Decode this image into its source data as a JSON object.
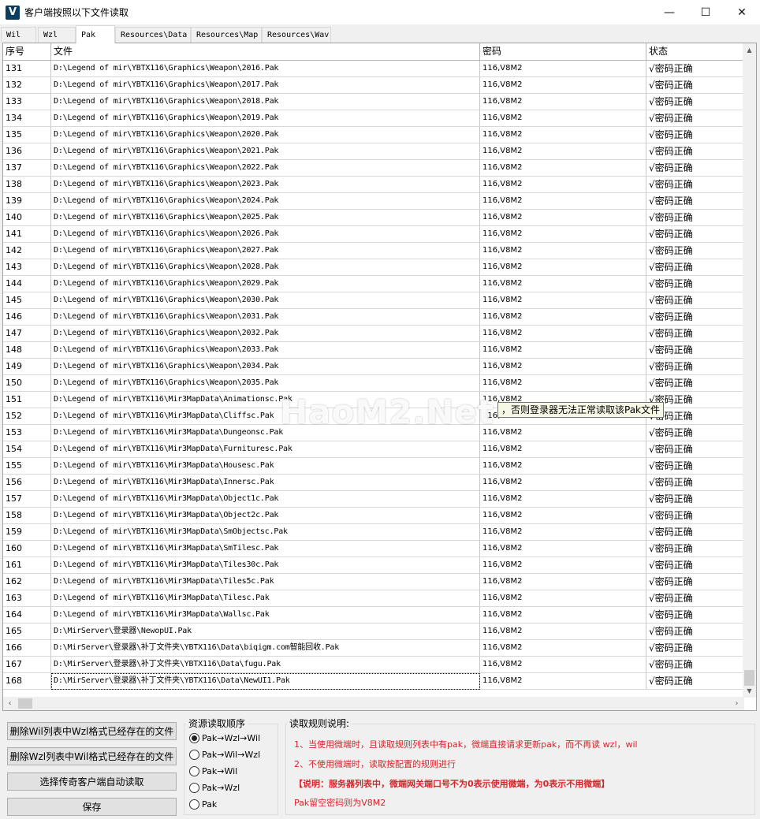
{
  "window": {
    "title": "客户端按照以下文件读取",
    "icon_letter": "V",
    "minimize": "—",
    "maximize": "☐",
    "close": "✕"
  },
  "tabs": [
    {
      "label": "Wil"
    },
    {
      "label": "Wzl"
    },
    {
      "label": "Pak"
    },
    {
      "label": "Resources\\Data"
    },
    {
      "label": "Resources\\Map"
    },
    {
      "label": "Resources\\Wav"
    }
  ],
  "active_tab": "Pak",
  "grid": {
    "columns": {
      "no": "序号",
      "file": "文件",
      "password": "密码",
      "status": "状态"
    },
    "rows": [
      {
        "no": "131",
        "file": "D:\\Legend of mir\\YBTX116\\Graphics\\Weapon\\2016.Pak",
        "password": "116,V8M2",
        "status": "√密码正确"
      },
      {
        "no": "132",
        "file": "D:\\Legend of mir\\YBTX116\\Graphics\\Weapon\\2017.Pak",
        "password": "116,V8M2",
        "status": "√密码正确"
      },
      {
        "no": "133",
        "file": "D:\\Legend of mir\\YBTX116\\Graphics\\Weapon\\2018.Pak",
        "password": "116,V8M2",
        "status": "√密码正确"
      },
      {
        "no": "134",
        "file": "D:\\Legend of mir\\YBTX116\\Graphics\\Weapon\\2019.Pak",
        "password": "116,V8M2",
        "status": "√密码正确"
      },
      {
        "no": "135",
        "file": "D:\\Legend of mir\\YBTX116\\Graphics\\Weapon\\2020.Pak",
        "password": "116,V8M2",
        "status": "√密码正确"
      },
      {
        "no": "136",
        "file": "D:\\Legend of mir\\YBTX116\\Graphics\\Weapon\\2021.Pak",
        "password": "116,V8M2",
        "status": "√密码正确"
      },
      {
        "no": "137",
        "file": "D:\\Legend of mir\\YBTX116\\Graphics\\Weapon\\2022.Pak",
        "password": "116,V8M2",
        "status": "√密码正确"
      },
      {
        "no": "138",
        "file": "D:\\Legend of mir\\YBTX116\\Graphics\\Weapon\\2023.Pak",
        "password": "116,V8M2",
        "status": "√密码正确"
      },
      {
        "no": "139",
        "file": "D:\\Legend of mir\\YBTX116\\Graphics\\Weapon\\2024.Pak",
        "password": "116,V8M2",
        "status": "√密码正确"
      },
      {
        "no": "140",
        "file": "D:\\Legend of mir\\YBTX116\\Graphics\\Weapon\\2025.Pak",
        "password": "116,V8M2",
        "status": "√密码正确"
      },
      {
        "no": "141",
        "file": "D:\\Legend of mir\\YBTX116\\Graphics\\Weapon\\2026.Pak",
        "password": "116,V8M2",
        "status": "√密码正确"
      },
      {
        "no": "142",
        "file": "D:\\Legend of mir\\YBTX116\\Graphics\\Weapon\\2027.Pak",
        "password": "116,V8M2",
        "status": "√密码正确"
      },
      {
        "no": "143",
        "file": "D:\\Legend of mir\\YBTX116\\Graphics\\Weapon\\2028.Pak",
        "password": "116,V8M2",
        "status": "√密码正确"
      },
      {
        "no": "144",
        "file": "D:\\Legend of mir\\YBTX116\\Graphics\\Weapon\\2029.Pak",
        "password": "116,V8M2",
        "status": "√密码正确"
      },
      {
        "no": "145",
        "file": "D:\\Legend of mir\\YBTX116\\Graphics\\Weapon\\2030.Pak",
        "password": "116,V8M2",
        "status": "√密码正确"
      },
      {
        "no": "146",
        "file": "D:\\Legend of mir\\YBTX116\\Graphics\\Weapon\\2031.Pak",
        "password": "116,V8M2",
        "status": "√密码正确"
      },
      {
        "no": "147",
        "file": "D:\\Legend of mir\\YBTX116\\Graphics\\Weapon\\2032.Pak",
        "password": "116,V8M2",
        "status": "√密码正确"
      },
      {
        "no": "148",
        "file": "D:\\Legend of mir\\YBTX116\\Graphics\\Weapon\\2033.Pak",
        "password": "116,V8M2",
        "status": "√密码正确"
      },
      {
        "no": "149",
        "file": "D:\\Legend of mir\\YBTX116\\Graphics\\Weapon\\2034.Pak",
        "password": "116,V8M2",
        "status": "√密码正确"
      },
      {
        "no": "150",
        "file": "D:\\Legend of mir\\YBTX116\\Graphics\\Weapon\\2035.Pak",
        "password": "116,V8M2",
        "status": "√密码正确"
      },
      {
        "no": "151",
        "file": "D:\\Legend of mir\\YBTX116\\Mir3MapData\\Animationsc.Pak",
        "password": "116,V8M2",
        "status": "√密码正确"
      },
      {
        "no": "152",
        "file": "D:\\Legend of mir\\YBTX116\\Mir3MapData\\Cliffsc.Pak",
        "password": "116,V8M2",
        "status": "√密码正确"
      },
      {
        "no": "153",
        "file": "D:\\Legend of mir\\YBTX116\\Mir3MapData\\Dungeonsc.Pak",
        "password": "116,V8M2",
        "status": "√密码正确"
      },
      {
        "no": "154",
        "file": "D:\\Legend of mir\\YBTX116\\Mir3MapData\\Furnituresc.Pak",
        "password": "116,V8M2",
        "status": "√密码正确"
      },
      {
        "no": "155",
        "file": "D:\\Legend of mir\\YBTX116\\Mir3MapData\\Housesc.Pak",
        "password": "116,V8M2",
        "status": "√密码正确"
      },
      {
        "no": "156",
        "file": "D:\\Legend of mir\\YBTX116\\Mir3MapData\\Innersc.Pak",
        "password": "116,V8M2",
        "status": "√密码正确"
      },
      {
        "no": "157",
        "file": "D:\\Legend of mir\\YBTX116\\Mir3MapData\\Object1c.Pak",
        "password": "116,V8M2",
        "status": "√密码正确"
      },
      {
        "no": "158",
        "file": "D:\\Legend of mir\\YBTX116\\Mir3MapData\\Object2c.Pak",
        "password": "116,V8M2",
        "status": "√密码正确"
      },
      {
        "no": "159",
        "file": "D:\\Legend of mir\\YBTX116\\Mir3MapData\\SmObjectsc.Pak",
        "password": "116,V8M2",
        "status": "√密码正确"
      },
      {
        "no": "160",
        "file": "D:\\Legend of mir\\YBTX116\\Mir3MapData\\SmTilesc.Pak",
        "password": "116,V8M2",
        "status": "√密码正确"
      },
      {
        "no": "161",
        "file": "D:\\Legend of mir\\YBTX116\\Mir3MapData\\Tiles30c.Pak",
        "password": "116,V8M2",
        "status": "√密码正确"
      },
      {
        "no": "162",
        "file": "D:\\Legend of mir\\YBTX116\\Mir3MapData\\Tiles5c.Pak",
        "password": "116,V8M2",
        "status": "√密码正确"
      },
      {
        "no": "163",
        "file": "D:\\Legend of mir\\YBTX116\\Mir3MapData\\Tilesc.Pak",
        "password": "116,V8M2",
        "status": "√密码正确"
      },
      {
        "no": "164",
        "file": "D:\\Legend of mir\\YBTX116\\Mir3MapData\\Wallsc.Pak",
        "password": "116,V8M2",
        "status": "√密码正确"
      },
      {
        "no": "165",
        "file": "D:\\MirServer\\登录器\\NewopUI.Pak",
        "password": "116,V8M2",
        "status": "√密码正确"
      },
      {
        "no": "166",
        "file": "D:\\MirServer\\登录器\\补丁文件夹\\YBTX116\\Data\\biqigm.com智能回收.Pak",
        "password": "116,V8M2",
        "status": "√密码正确"
      },
      {
        "no": "167",
        "file": "D:\\MirServer\\登录器\\补丁文件夹\\YBTX116\\Data\\fugu.Pak",
        "password": "116,V8M2",
        "status": "√密码正确"
      },
      {
        "no": "168",
        "file": "D:\\MirServer\\登录器\\补丁文件夹\\YBTX116\\Data\\NewUI1.Pak",
        "password": "116,V8M2",
        "status": "√密码正确"
      }
    ]
  },
  "watermark": "HaoM2.Net",
  "tooltip": "，否则登录器无法正常读取该Pak文件",
  "buttons": {
    "delete_wil": "删除Wil列表中Wzl格式已经存在的文件",
    "delete_wzl": "删除Wzl列表中Wil格式已经存在的文件",
    "auto_read": "选择传奇客户端自动读取",
    "save": "保存"
  },
  "order_group": {
    "title": "资源读取顺序",
    "options": [
      {
        "label": "Pak→Wzl→Wil",
        "checked": true
      },
      {
        "label": "Pak→Wil→Wzl",
        "checked": false
      },
      {
        "label": "Pak→Wil",
        "checked": false
      },
      {
        "label": "Pak→Wzl",
        "checked": false
      },
      {
        "label": "Pak",
        "checked": false
      }
    ]
  },
  "rules_group": {
    "title": "读取规则说明:",
    "lines": [
      "1、当使用微端时，且读取规则列表中有pak，微端直接请求更新pak，而不再读 wzl，wil",
      "2、不使用微端时，读取按配置的规则进行",
      "【说明：服务器列表中，微端网关端口号不为0表示使用微端，为0表示不用微端】",
      "Pak留空密码则为V8M2"
    ]
  },
  "colors": {
    "rules_text": "#d6262b",
    "icon_bg": "#0b3d5e"
  }
}
